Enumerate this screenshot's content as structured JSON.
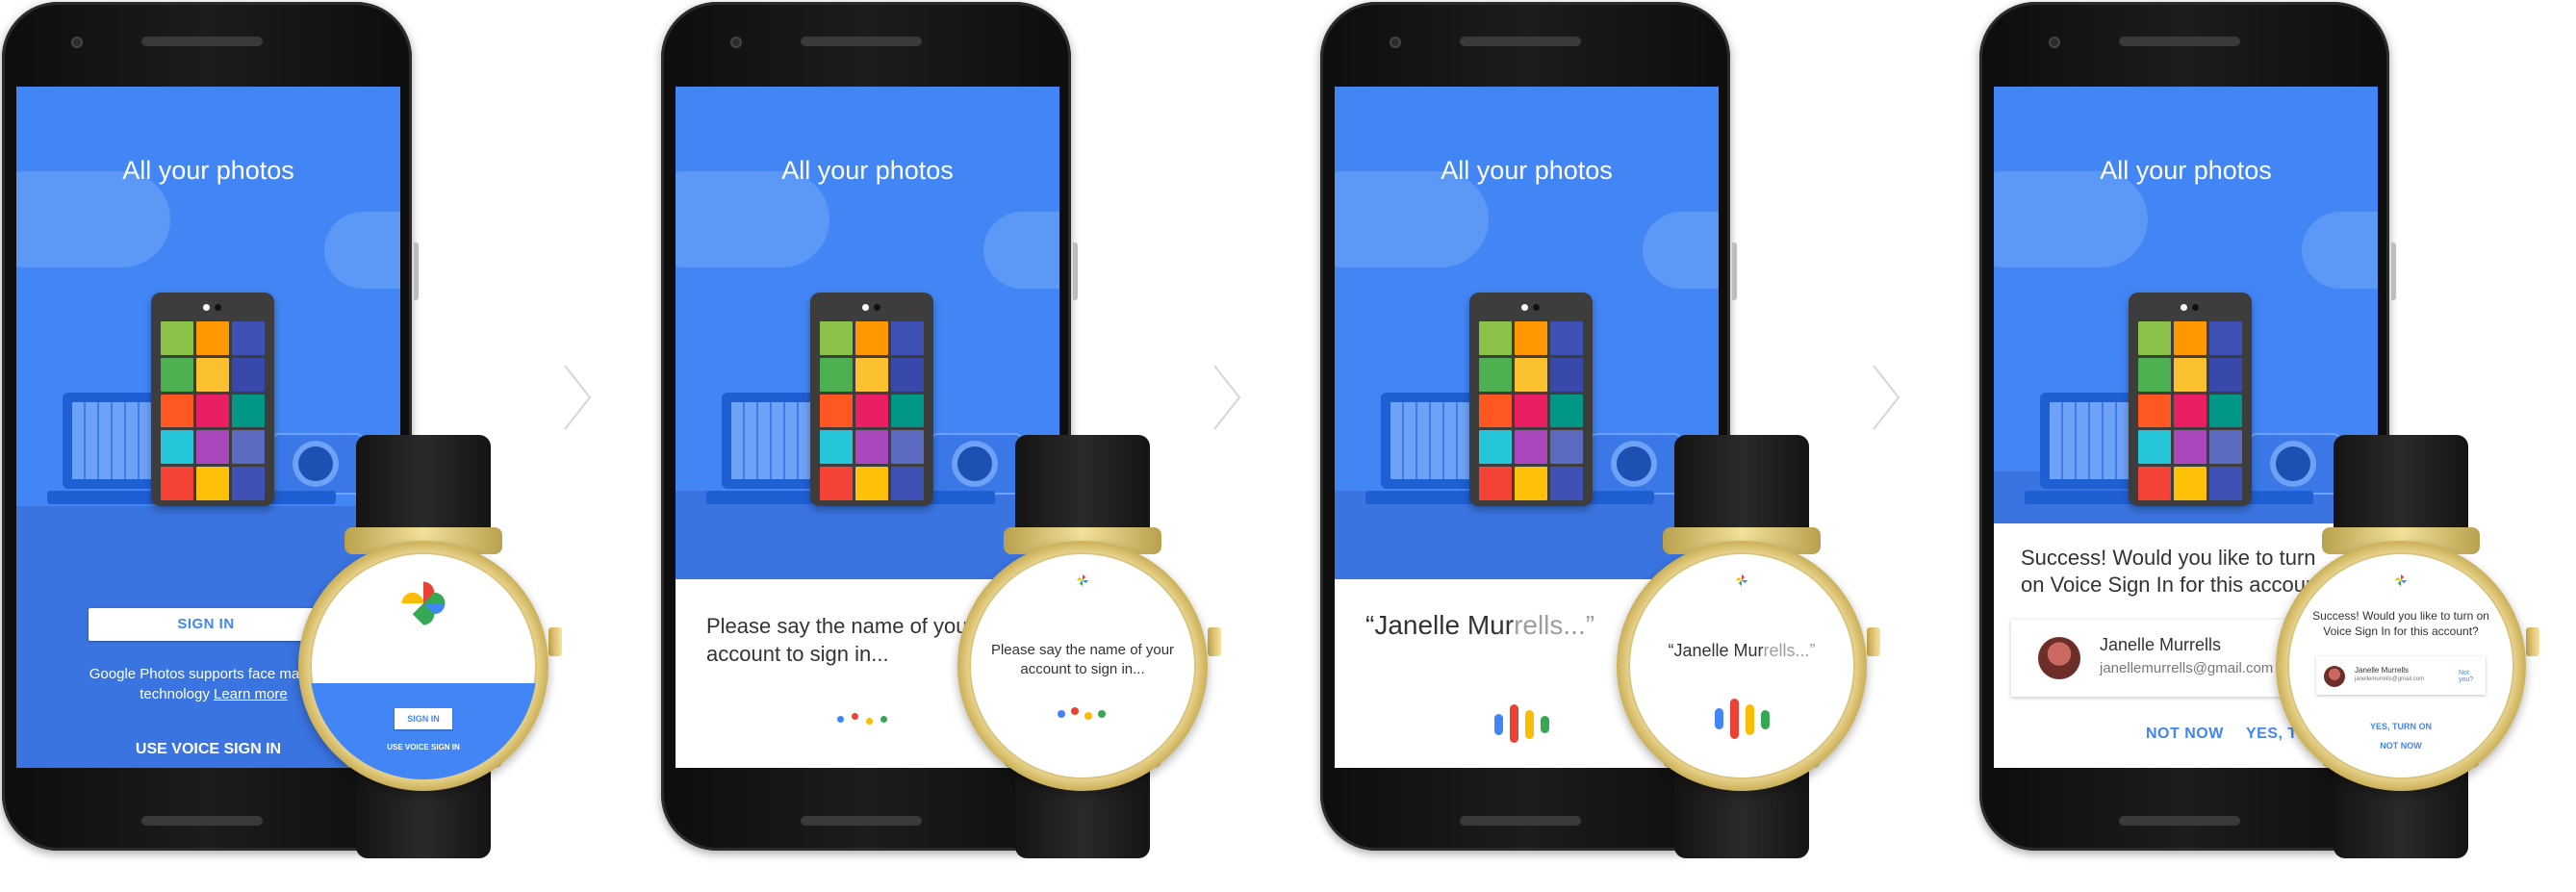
{
  "colors": {
    "primary_blue": "#4285f4",
    "google_blue": "#4285f4",
    "google_red": "#ea4335",
    "google_yellow": "#fbbc05",
    "google_green": "#34a853"
  },
  "steps": [
    {
      "title": "All your photos",
      "sign_in_button": "SIGN IN",
      "notice_text": "Google Photos supports face matching technology",
      "learn_more": "Learn more",
      "voice_sign_in": "USE VOICE SIGN IN",
      "watch": {
        "sign_in_button": "SIGN IN",
        "voice_sign_in": "USE VOICE SIGN IN",
        "logo": "google-photos-pinwheel-icon"
      }
    },
    {
      "title": "All your photos",
      "prompt": "Please say the name of your account to sign in...",
      "watch": {
        "prompt": "Please say the name of your account to sign in..."
      }
    },
    {
      "title": "All your photos",
      "quote_start": "“Janelle Mur",
      "quote_fade": "rells...”",
      "watch": {
        "quote_start": "“Janelle Mur",
        "quote_fade": "rells...”"
      }
    },
    {
      "title": "All your photos",
      "success_text": "Success! Would you like to turn on Voice Sign In for this account?",
      "account_name": "Janelle Murrells",
      "account_email": "janellemurrells@gmail.com",
      "not_now": "NOT NOW",
      "yes_turn_on": "YES, TURN ON",
      "watch": {
        "success_text": "Success! Would you like to turn on Voice Sign In for this account?",
        "account_name": "Janelle Murrells",
        "account_email": "janellemurrells@gmail.com",
        "not_you": "Not you?",
        "yes_turn_on": "YES, TURN ON",
        "not_now": "NOT NOW"
      }
    }
  ]
}
